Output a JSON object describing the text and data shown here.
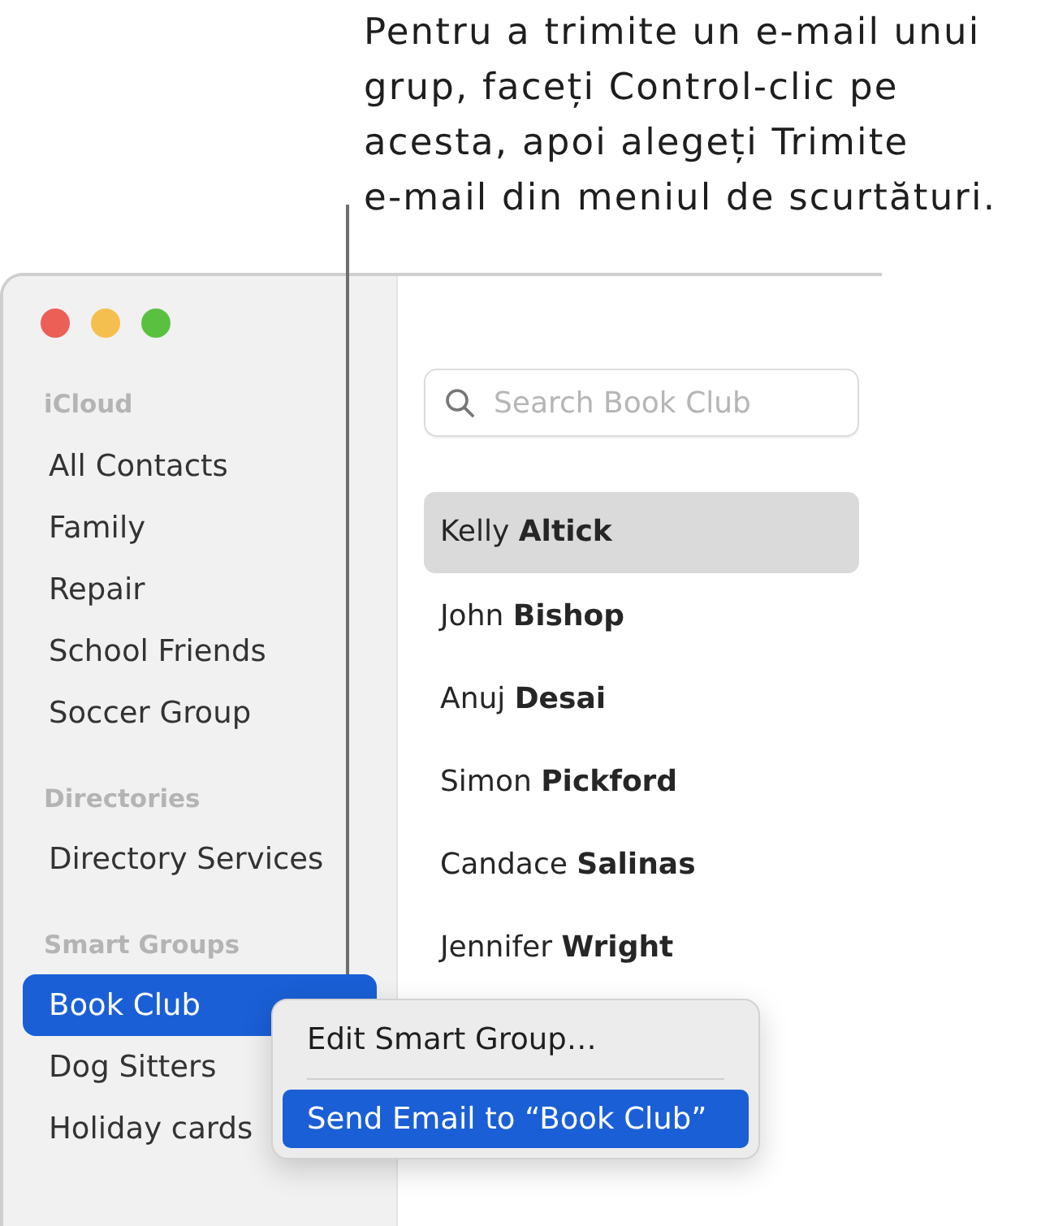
{
  "callout": {
    "text": "Pentru a trimite un e-mail unui\ngrup, faceți Control-clic pe\nacesta, apoi alegeți Trimite\ne-mail din meniul de scurtături."
  },
  "sidebar": {
    "sections": [
      {
        "header": "iCloud",
        "items": [
          {
            "label": "All Contacts",
            "selected": false
          },
          {
            "label": "Family",
            "selected": false
          },
          {
            "label": "Repair",
            "selected": false
          },
          {
            "label": "School Friends",
            "selected": false
          },
          {
            "label": "Soccer Group",
            "selected": false
          }
        ]
      },
      {
        "header": "Directories",
        "items": [
          {
            "label": "Directory Services",
            "selected": false
          }
        ]
      },
      {
        "header": "Smart Groups",
        "items": [
          {
            "label": "Book Club",
            "selected": true
          },
          {
            "label": "Dog Sitters",
            "selected": false
          },
          {
            "label": "Holiday cards",
            "selected": false
          }
        ]
      }
    ]
  },
  "search": {
    "placeholder": "Search Book Club"
  },
  "contacts": [
    {
      "name": "Kelly **Altick**",
      "selected": true
    },
    {
      "name": "John **Bishop**",
      "selected": false
    },
    {
      "name": "Anuj **Desai**",
      "selected": false
    },
    {
      "name": "Simon **Pickford**",
      "selected": false
    },
    {
      "name": "Candace **Salinas**",
      "selected": false
    },
    {
      "name": "Jennifer **Wright**",
      "selected": false
    }
  ],
  "context_menu": {
    "items": [
      {
        "kind": "item",
        "label": "Edit Smart Group…",
        "selected": false
      },
      {
        "kind": "separator"
      },
      {
        "kind": "item",
        "label": "Send Email to “Book Club”",
        "selected": true
      }
    ]
  }
}
